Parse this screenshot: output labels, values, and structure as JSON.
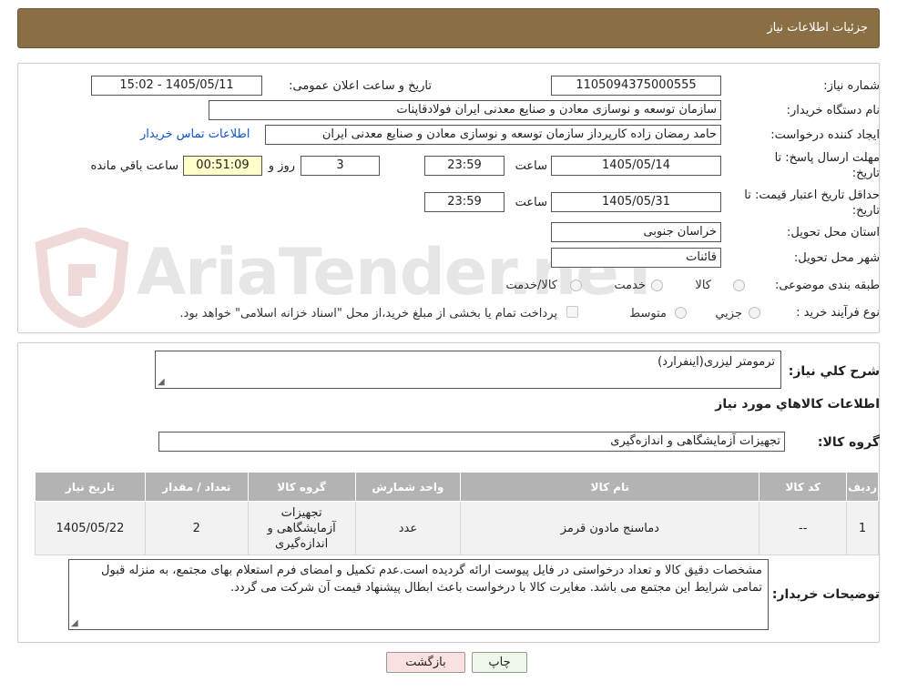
{
  "header": {
    "title": "جزئیات اطلاعات نیاز"
  },
  "info": {
    "need_number_label": "شماره نیاز:",
    "need_number": "1105094375000555",
    "announce_label": "تاریخ و ساعت اعلان عمومی:",
    "announce_value": "1405/05/11 - 15:02",
    "buyer_org_label": "نام دستگاه خریدار:",
    "buyer_org": "سازمان توسعه و نوسازی معادن و صنایع معدنی ایران فولادقاپنات",
    "requester_label": "ایجاد کننده درخواست:",
    "requester": "حامد  رمضان زاده  کارپرداز  سازمان توسعه و نوسازی معادن و صنایع معدنی ایران",
    "contact_link": "اطلاعات تماس خریدار",
    "deadline_label_1": "مهلت ارسال پاسخ: تا",
    "deadline_label_2": "تاریخ:",
    "deadline_date": "1405/05/14",
    "time_label": "ساعت",
    "deadline_time": "23:59",
    "days_value": "3",
    "days_label": "روز و",
    "remaining_time": "00:51:09",
    "remaining_label": "ساعت باقي مانده",
    "validity_label_1": "حداقل تاریخ اعتبار قیمت: تا",
    "validity_label_2": "تاریخ:",
    "validity_date": "1405/05/31",
    "validity_time": "23:59",
    "province_label": "استان محل تحویل:",
    "province": "خراسان جنوبی",
    "city_label": "شهر محل تحویل:",
    "city": "قائنات",
    "category_label": "طبقه بندی موضوعی:",
    "category_options": [
      "کالا",
      "خدمت",
      "کالا/خدمت"
    ],
    "process_label": "نوع فرآیند خرید :",
    "process_options": [
      "جزیي",
      "متوسط"
    ],
    "treasury_note": "پرداخت تمام یا بخشی از مبلغ خرید،از محل \"اسناد خزانه اسلامی\" خواهد بود."
  },
  "watermark": {
    "text": "AriaTender.neT"
  },
  "summary": {
    "general_desc_label": "شرح کلي نیاز:",
    "general_desc": "ترمومتر لیزری(اینفرارد)",
    "goods_info_title": "اطلاعات کالاهاي مورد نياز",
    "goods_group_label": "گروه کالا:",
    "goods_group": "تجهیزات آزمایشگاهی و اندازه‌گیری"
  },
  "table": {
    "headers": [
      "رديف",
      "کد کالا",
      "نام کالا",
      "واحد شمارش",
      "گروه کالا",
      "تعداد / مقدار",
      "تاریخ نیاز"
    ],
    "rows": [
      [
        "1",
        "--",
        "دماسنج مادون قرمز",
        "عدد",
        "تجهیزات آزمایشگاهی و اندازه‌گیری",
        "2",
        "1405/05/22"
      ]
    ]
  },
  "buyer_notes": {
    "label": "توضیحات خریدار:",
    "text": "مشخصات دقیق کالا و تعداد درخواستی در فایل پیوست ارائه گردیده است.عدم تکمیل و امضای فرم استعلام بهای مجتمع، به منزله قبول تمامی شرایط این مجتمع می باشد. مغایرت کالا با درخواست باعث ابطال پیشنهاد قیمت آن شرکت می گردد."
  },
  "buttons": {
    "print": "چاپ",
    "back": "بازگشت"
  }
}
